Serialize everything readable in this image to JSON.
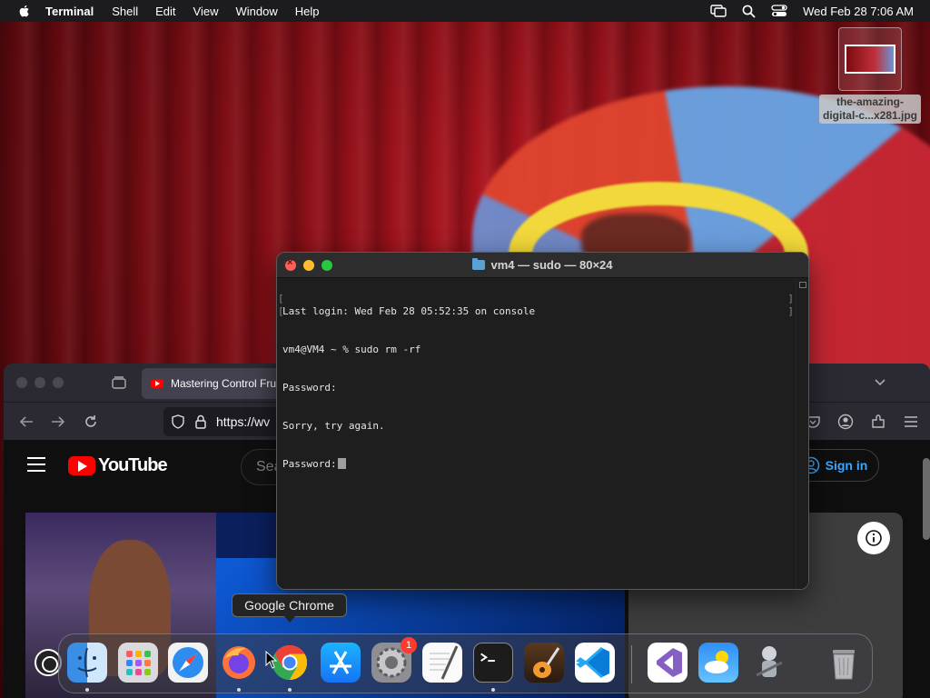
{
  "menubar": {
    "app_name": "Terminal",
    "menus": [
      "Shell",
      "Edit",
      "View",
      "Window",
      "Help"
    ],
    "clock": "Wed Feb 28  7:06 AM"
  },
  "desktop": {
    "file_label_line1": "the-amazing-",
    "file_label_line2": "digital-c...x281.jpg"
  },
  "terminal": {
    "title": "vm4 — sudo — 80×24",
    "lines": [
      "Last login: Wed Feb 28 05:52:35 on console",
      "vm4@VM4 ~ % sudo rm -rf",
      "Password:",
      "Sorry, try again.",
      "Password:"
    ]
  },
  "browser": {
    "tab_title": "Mastering Control Frui",
    "url": "https://wv",
    "youtube": {
      "logo_text": "YouTube",
      "search_placeholder": "Sea",
      "sign_in": "Sign in"
    }
  },
  "tooltip": "Google Chrome",
  "dock": {
    "apps": [
      {
        "name": "Finder",
        "running": true
      },
      {
        "name": "Launchpad",
        "running": false
      },
      {
        "name": "Safari",
        "running": false
      },
      {
        "name": "Firefox",
        "running": true
      },
      {
        "name": "Google Chrome",
        "running": true
      },
      {
        "name": "App Store",
        "running": false
      },
      {
        "name": "System Settings",
        "running": false,
        "badge": "1"
      },
      {
        "name": "TextEdit",
        "running": false
      },
      {
        "name": "Terminal",
        "running": true
      },
      {
        "name": "GarageBand",
        "running": false
      },
      {
        "name": "Visual Studio Code",
        "running": false
      },
      {
        "name": "Visual Studio",
        "running": false
      },
      {
        "name": "Weather",
        "running": false
      },
      {
        "name": "Automator",
        "running": false
      },
      {
        "name": "Trash",
        "running": false
      }
    ]
  },
  "colors": {
    "terminal_bg": "#1e1e1e",
    "youtube_red": "#ff0000",
    "signin_blue": "#3ea6ff",
    "close": "#ff5f57",
    "minimize": "#febc2e",
    "maximize": "#28c840"
  }
}
